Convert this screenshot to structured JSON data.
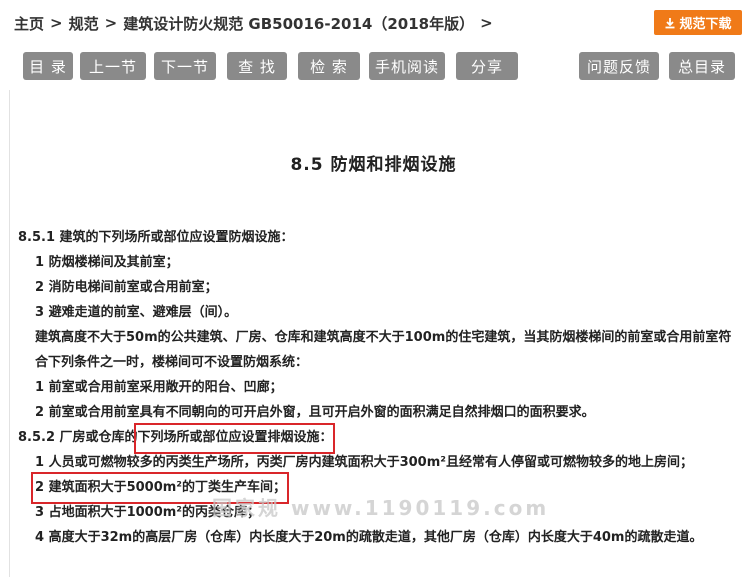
{
  "breadcrumb": {
    "home": "主页",
    "sep": ">",
    "category": "规范",
    "current": "建筑设计防火规范 GB50016-2014（2018年版）"
  },
  "download": {
    "label": "规范下载",
    "icon": "download-icon",
    "color": "#f07a18"
  },
  "toolbar": [
    {
      "label": "目 录"
    },
    {
      "label": "上一节"
    },
    {
      "label": "下一节"
    },
    {
      "label": "查 找"
    },
    {
      "label": "检 索"
    },
    {
      "label": "手机阅读"
    },
    {
      "label": "分享"
    },
    {
      "label": "问题反馈"
    },
    {
      "label": "总目录"
    }
  ],
  "section": {
    "title": "8.5 防烟和排烟设施"
  },
  "content": {
    "p1": "8.5.1 建筑的下列场所或部位应设置防烟设施：",
    "p1_1": "1 防烟楼梯间及其前室；",
    "p1_2": "2 消防电梯间前室或合用前室；",
    "p1_3": "3 避难走道的前室、避难层（间）。",
    "p1_4": "建筑高度不大于50m的公共建筑、厂房、仓库和建筑高度不大于100m的住宅建筑，当其防烟楼梯间的前室或合用前室符合下列条件之一时，楼梯间可不设置防烟系统：",
    "p1_5": "1 前室或合用前室采用敞开的阳台、凹廊；",
    "p1_6": "2 前室或合用前室具有不同朝向的可开启外窗，且可开启外窗的面积满足自然排烟口的面积要求。",
    "p2_a": "8.5.2 厂房或仓库的",
    "p2_b": "下列场所或部位应设置排烟设施：",
    "p2_1": "1 人员或可燃物较多的丙类生产场所，丙类厂房内建筑面积大于300m²且经常有人停留或可燃物较多的地上房间；",
    "p2_2": "2 建筑面积大于5000m²的丁类生产车间；",
    "p2_3": "3 占地面积大于1000m²的丙类仓库；",
    "p2_4": "4 高度大于32m的高层厂房（仓库）内长度大于20m的疏散走道，其他厂房（仓库）内长度大于40m的疏散走道。"
  },
  "watermark": "国家规  www.1190119.com",
  "highlight_color": "#d9262a"
}
